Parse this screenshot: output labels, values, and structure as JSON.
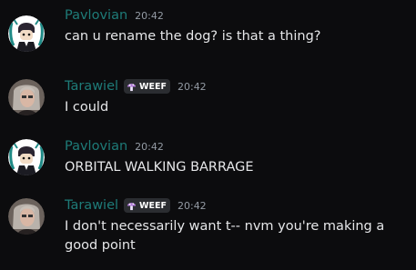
{
  "colors": {
    "name_color": "#1e7b78",
    "timestamp": "#949ba4",
    "text": "#e6e7e9",
    "background": "#0c0c0e"
  },
  "messages": [
    {
      "author": "Pavlovian",
      "timestamp": "20:42",
      "text": "can u rename the dog? is that a thing?"
    },
    {
      "author": "Tarawiel",
      "tag": "WEEF",
      "timestamp": "20:42",
      "text": "I could"
    },
    {
      "author": "Pavlovian",
      "timestamp": "20:42",
      "text": "ORBITAL WALKING BARRAGE"
    },
    {
      "author": "Tarawiel",
      "tag": "WEEF",
      "timestamp": "20:42",
      "text": "I don't necessarily want t-- nvm you're making a good point"
    }
  ]
}
